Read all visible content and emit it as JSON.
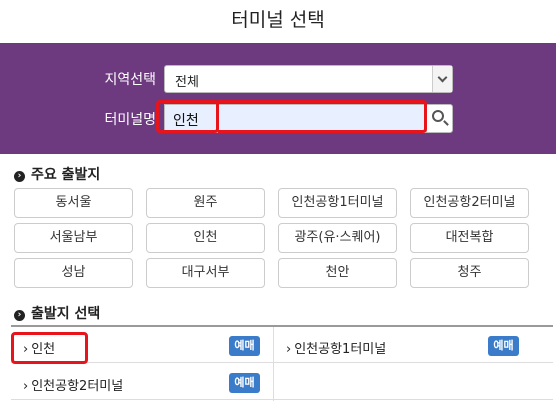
{
  "title": "터미널 선택",
  "search": {
    "region_label": "지역선택",
    "region_value": "전체",
    "terminal_label": "터미널명",
    "terminal_value": "인천"
  },
  "major": {
    "heading": "주요 출발지",
    "items": [
      "동서울",
      "원주",
      "인천공항1터미널",
      "인천공항2터미널",
      "서울남부",
      "인천",
      "광주(유·스퀘어)",
      "대전복합",
      "성남",
      "대구서부",
      "천안",
      "청주"
    ]
  },
  "departure": {
    "heading": "출발지 선택",
    "book_label": "예매",
    "rows": [
      "인천",
      "인천공항1터미널",
      "인천공항2터미널"
    ]
  },
  "colors": {
    "panel": "#6d3a80",
    "highlight": "#e8141c",
    "book": "#3a7cc9"
  },
  "icons": {
    "region_dropdown": "chevron-down-icon",
    "search": "search-icon",
    "bullet": "chevron-right-circle-icon"
  }
}
